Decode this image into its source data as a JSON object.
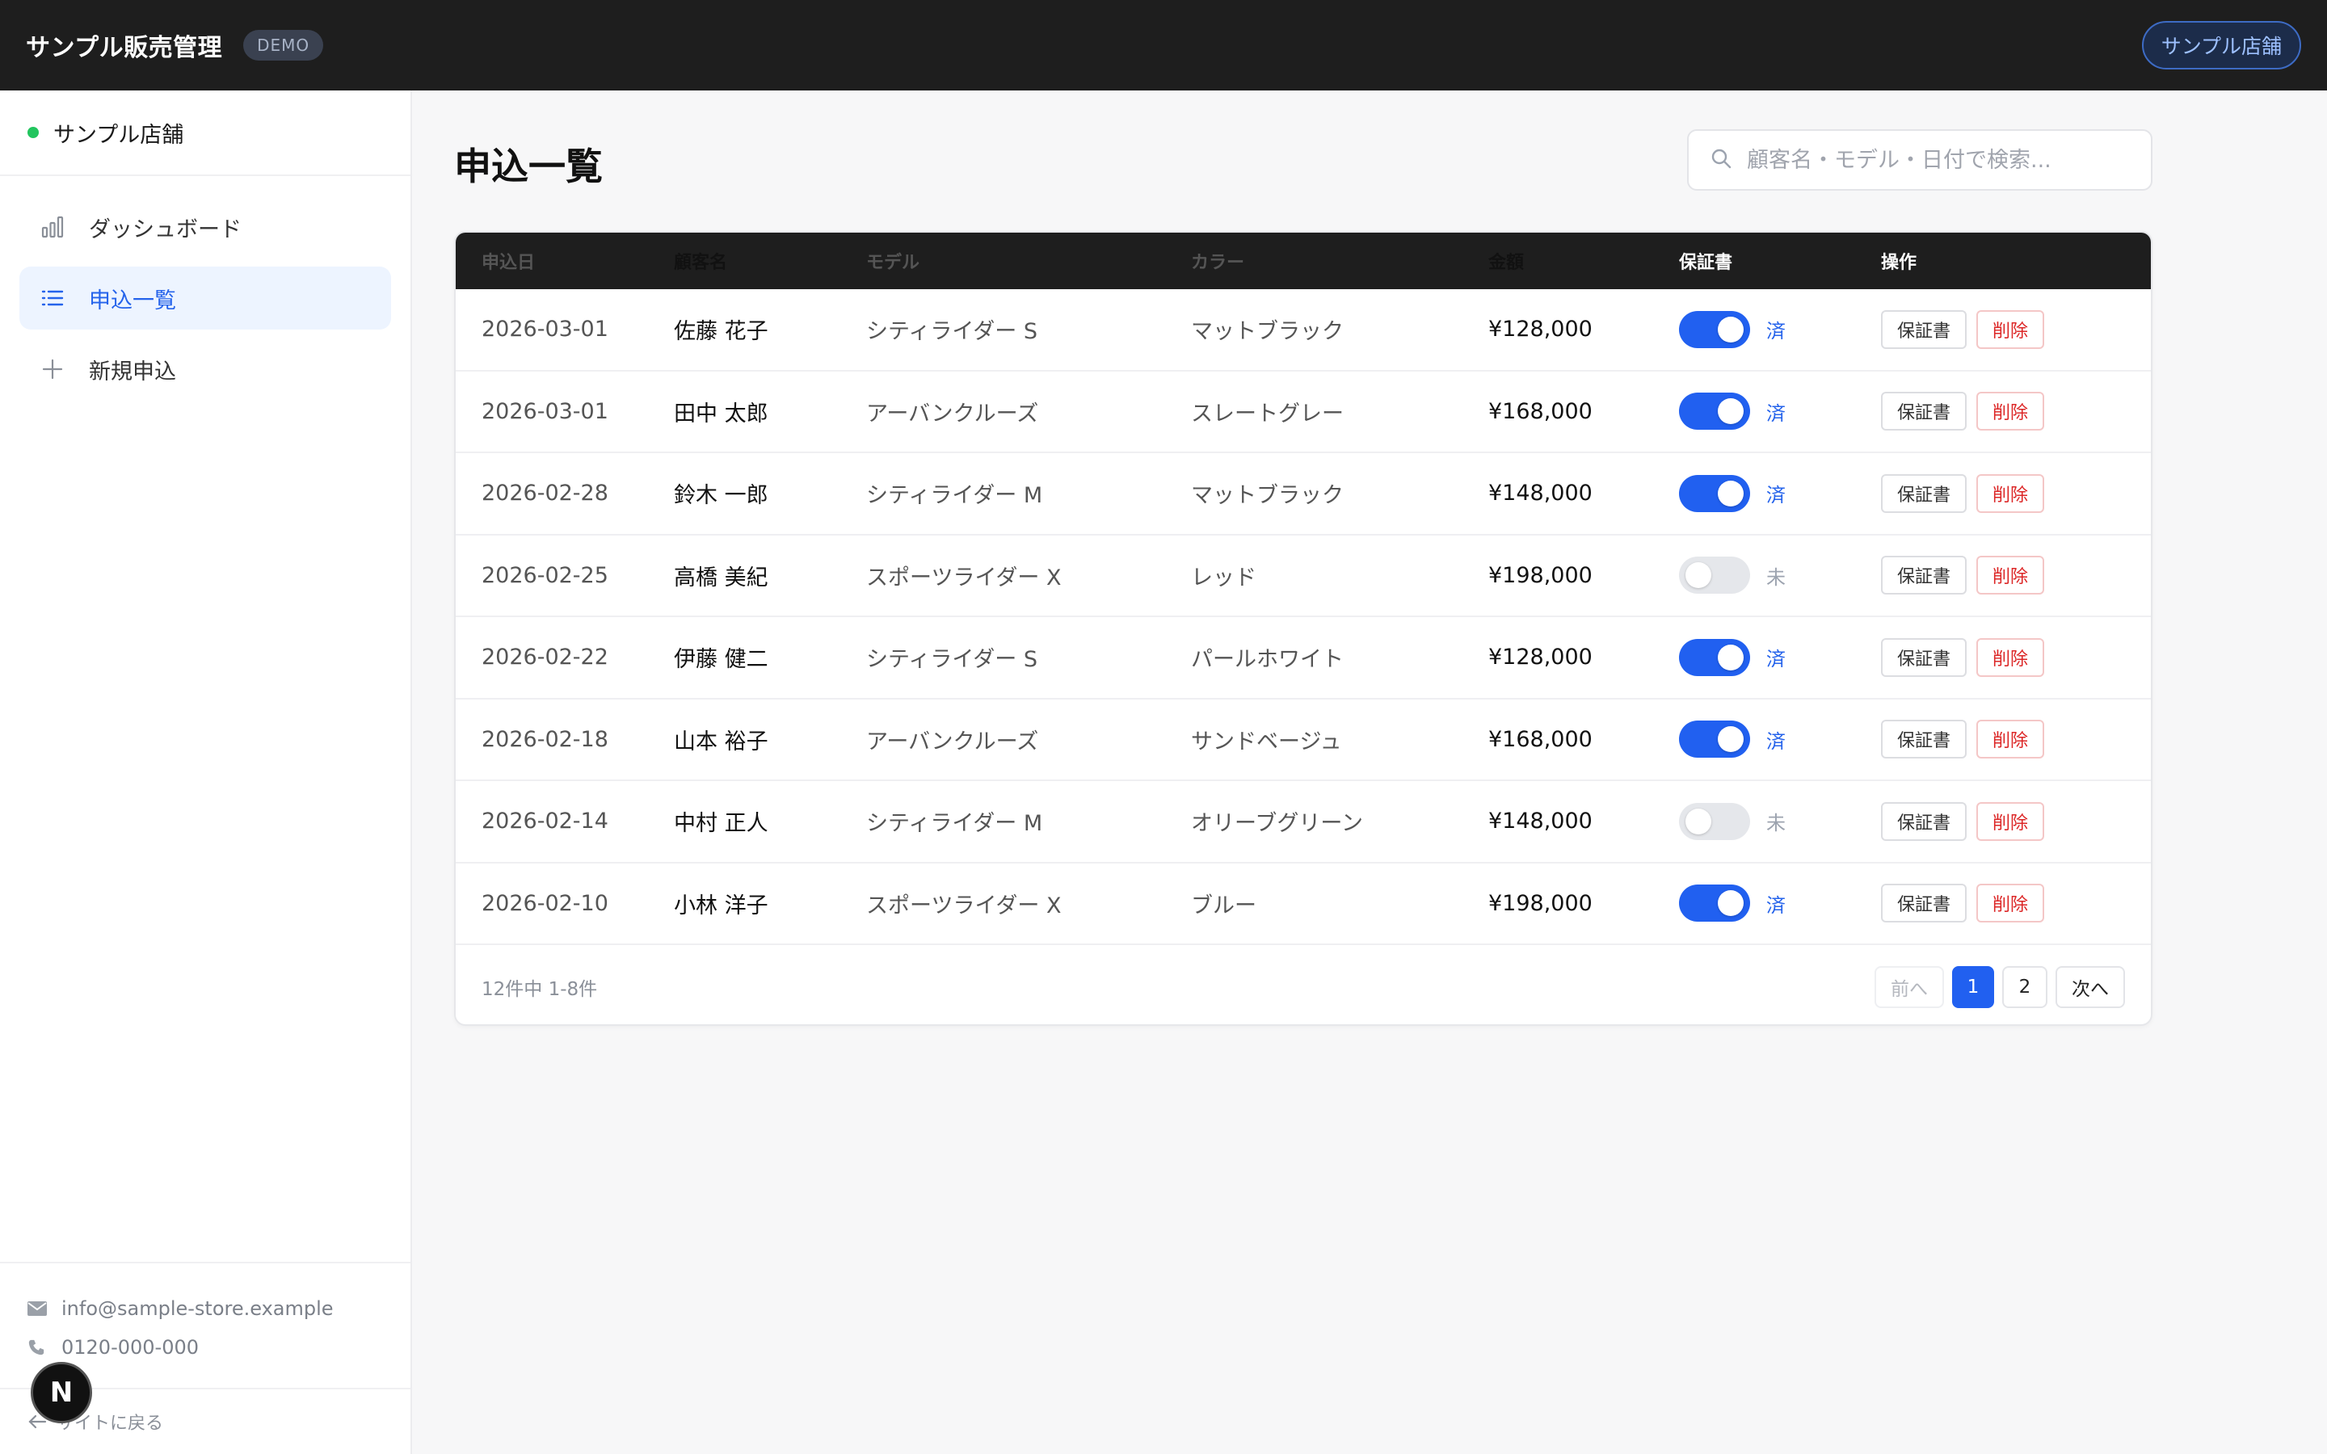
{
  "header": {
    "brand": "サンプル販売管理",
    "badge": "DEMO",
    "store_button": "サンプル店舗"
  },
  "sidebar": {
    "store_name": "サンプル店舗",
    "status_color": "#22c55e",
    "items": [
      {
        "label": "ダッシュボード",
        "icon": "bar-chart-icon",
        "active": false
      },
      {
        "label": "申込一覧",
        "icon": "list-icon",
        "active": true
      },
      {
        "label": "新規申込",
        "icon": "plus-icon",
        "active": false
      }
    ],
    "email": "info@sample-store.example",
    "phone": "0120-000-000",
    "back_link": "サイトに戻る",
    "floating_badge": "N"
  },
  "main": {
    "title": "申込一覧",
    "search": {
      "placeholder": "顧客名・モデル・日付で検索...",
      "value": ""
    },
    "table": {
      "columns": [
        "申込日",
        "顧客名",
        "モデル",
        "カラー",
        "金額",
        "保証書",
        "操作"
      ],
      "warranty_on_label": "済",
      "warranty_off_label": "未",
      "warranty_button": "保証書",
      "delete_button": "削除",
      "rows": [
        {
          "date": "2026-03-01",
          "name": "佐藤 花子",
          "model": "シティライダー S",
          "color": "マットブラック",
          "amount": "¥128,000",
          "warranty": true,
          "warranty_label": "済"
        },
        {
          "date": "2026-03-01",
          "name": "田中 太郎",
          "model": "アーバンクルーズ",
          "color": "スレートグレー",
          "amount": "¥168,000",
          "warranty": true,
          "warranty_label": "済"
        },
        {
          "date": "2026-02-28",
          "name": "鈴木 一郎",
          "model": "シティライダー M",
          "color": "マットブラック",
          "amount": "¥148,000",
          "warranty": true,
          "warranty_label": "済"
        },
        {
          "date": "2026-02-25",
          "name": "高橋 美紀",
          "model": "スポーツライダー X",
          "color": "レッド",
          "amount": "¥198,000",
          "warranty": false,
          "warranty_label": "未"
        },
        {
          "date": "2026-02-22",
          "name": "伊藤 健二",
          "model": "シティライダー S",
          "color": "パールホワイト",
          "amount": "¥128,000",
          "warranty": true,
          "warranty_label": "済"
        },
        {
          "date": "2026-02-18",
          "name": "山本 裕子",
          "model": "アーバンクルーズ",
          "color": "サンドベージュ",
          "amount": "¥168,000",
          "warranty": true,
          "warranty_label": "済"
        },
        {
          "date": "2026-02-14",
          "name": "中村 正人",
          "model": "シティライダー M",
          "color": "オリーブグリーン",
          "amount": "¥148,000",
          "warranty": false,
          "warranty_label": "未"
        },
        {
          "date": "2026-02-10",
          "name": "小林 洋子",
          "model": "スポーツライダー X",
          "color": "ブルー",
          "amount": "¥198,000",
          "warranty": true,
          "warranty_label": "済"
        }
      ]
    },
    "pagination": {
      "summary": "12件中 1-8件",
      "prev": "前へ",
      "next": "次へ",
      "pages": [
        "1",
        "2"
      ],
      "current": "1"
    }
  },
  "colors": {
    "accent": "#2160f0",
    "header_bg": "#1e1e1e",
    "delete": "#dc2626"
  }
}
